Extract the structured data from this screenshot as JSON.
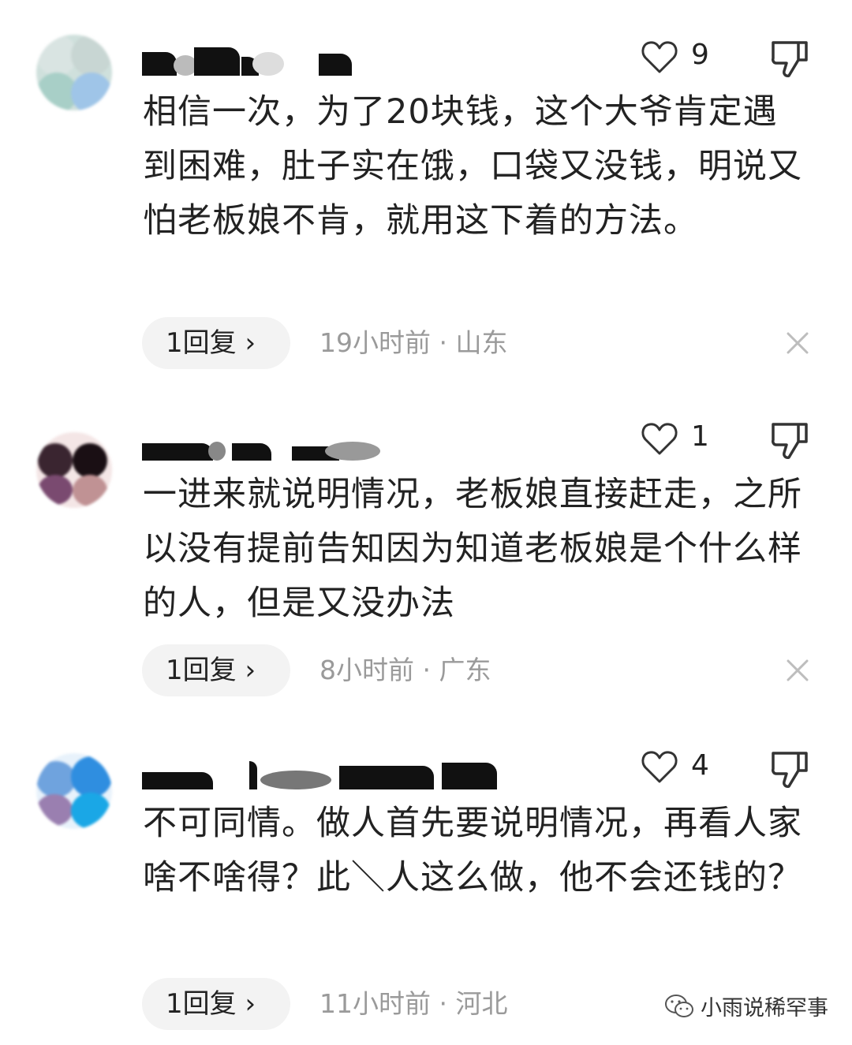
{
  "comments": [
    {
      "text": "相信一次，为了20块钱，这个大爷肯定遇到困难，肚子实在饿，口袋又没钱，明说又怕老板娘不肯，就用这下着的方法。",
      "likes": "9",
      "reply_label": "1回复 ›",
      "meta": "19小时前 · 山东"
    },
    {
      "text": "一进来就说明情况，老板娘直接赶走，之所以没有提前告知因为知道老板娘是个什么样的人，但是又没办法",
      "likes": "1",
      "reply_label": "1回复 ›",
      "meta": "8小时前 · 广东"
    },
    {
      "text": "不可同情。做人首先要说明情况，再看人家啥不啥得？此＼人这么做，他不会还钱的？",
      "likes": "4",
      "reply_label": "1回复 ›",
      "meta": "11小时前 · 河北"
    }
  ],
  "watermark": {
    "text": "小雨说稀罕事",
    "icon": "wechat-icon"
  },
  "colors": {
    "text": "#222222",
    "meta": "#9a9a9a",
    "reply_bg": "#f3f3f3"
  }
}
